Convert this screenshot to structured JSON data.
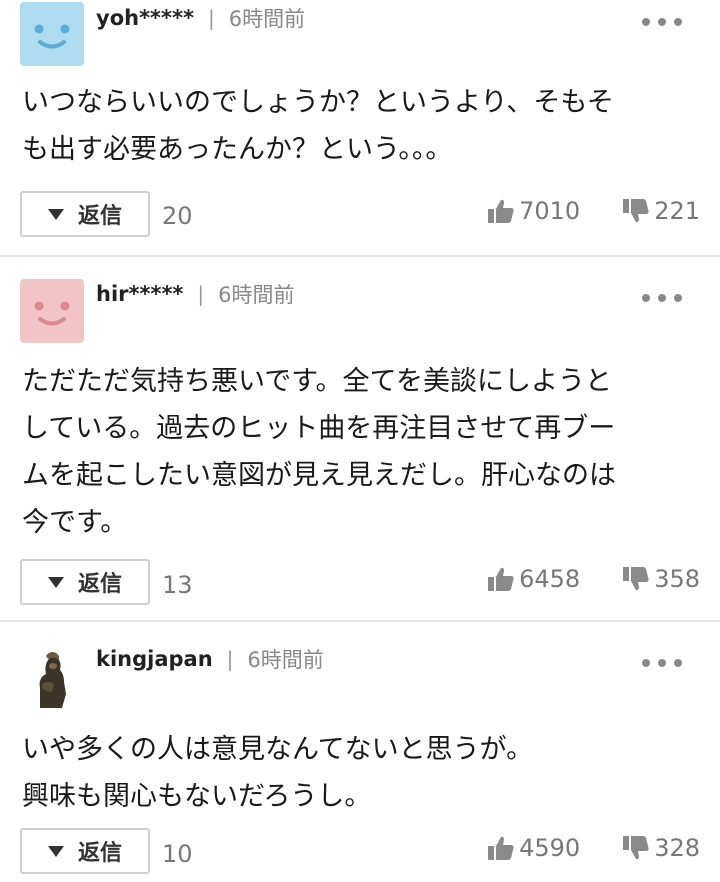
{
  "comments": [
    {
      "username": "yoh*****",
      "time": "6時間前",
      "lines": [
        "いつならいいのでしょうか？というより、そもそ",
        "も出す必要あったんか？という。。。"
      ],
      "reply_label": "返信",
      "reply_count": "20",
      "likes": "7010",
      "dislikes": "221",
      "avatar": "smiley-blue",
      "avatar_color": "#aedcf0",
      "avatar_face_color": "#5aaed6"
    },
    {
      "username": "hir*****",
      "time": "6時間前",
      "lines": [
        "ただただ気持ち悪いです。全てを美談にしようと",
        "している。過去のヒット曲を再注目させて再ブー",
        "ムを起こしたい意図が見え見えだし。肝心なのは",
        "今です。"
      ],
      "reply_label": "返信",
      "reply_count": "13",
      "likes": "6458",
      "dislikes": "358",
      "avatar": "smiley-pink",
      "avatar_color": "#f2c4c6",
      "avatar_face_color": "#d98a8f"
    },
    {
      "username": "kingjapan",
      "time": "6時間前",
      "lines": [
        "いや多くの人は意見なんてないと思うが。",
        "興味も関心もないだろうし。"
      ],
      "reply_label": "返信",
      "reply_count": "10",
      "likes": "4590",
      "dislikes": "328",
      "avatar": "statue-photo"
    }
  ],
  "separator": "|",
  "icons": {
    "more": "more-dots-icon",
    "like": "thumbs-up-icon",
    "dislike": "thumbs-down-icon",
    "reply": "triangle-down-icon"
  }
}
